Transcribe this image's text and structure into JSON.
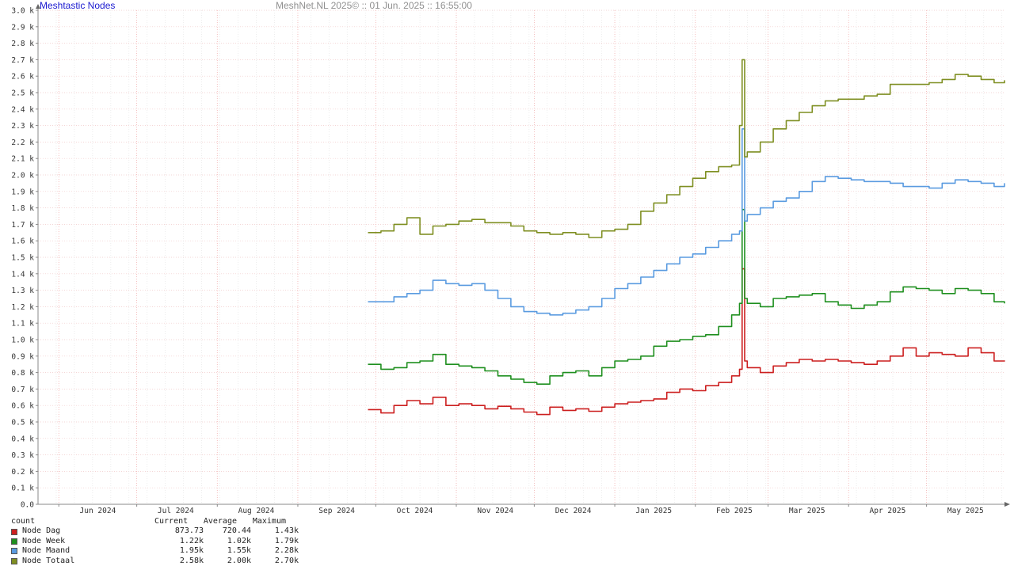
{
  "header": {
    "chart_title": "Meshtastic Nodes",
    "watermark": "MeshNet.NL 2025© ::  01 Jun. 2025 :: 16:55:00"
  },
  "legend": {
    "count_label": "count",
    "columns": [
      "Current",
      "Average",
      "Maximum"
    ],
    "rows": [
      {
        "name": "Node Dag",
        "color": "#cc1f1f",
        "current": "873.73",
        "average": "720.44",
        "maximum": "1.43k"
      },
      {
        "name": "Node Week",
        "color": "#1f8f1f",
        "current": "1.22k",
        "average": "1.02k",
        "maximum": "1.79k"
      },
      {
        "name": "Node Maand",
        "color": "#5a9be0",
        "current": "1.95k",
        "average": "1.55k",
        "maximum": "2.28k"
      },
      {
        "name": "Node Totaal",
        "color": "#7f8f22",
        "current": "2.58k",
        "average": "2.00k",
        "maximum": "2.70k"
      }
    ]
  },
  "chart_data": {
    "type": "line",
    "x_unit": "date",
    "x_range": [
      "2024-05-24",
      "2025-05-31"
    ],
    "ylim": [
      0,
      3000
    ],
    "y_tick_labels": [
      "0.0",
      "0.1 k",
      "0.2 k",
      "0.3 k",
      "0.4 k",
      "0.5 k",
      "0.6 k",
      "0.7 k",
      "0.8 k",
      "0.9 k",
      "1.0 k",
      "1.1 k",
      "1.2 k",
      "1.3 k",
      "1.4 k",
      "1.5 k",
      "1.6 k",
      "1.7 k",
      "1.8 k",
      "1.9 k",
      "2.0 k",
      "2.1 k",
      "2.2 k",
      "2.3 k",
      "2.4 k",
      "2.5 k",
      "2.6 k",
      "2.7 k",
      "2.8 k",
      "2.9 k",
      "3.0 k"
    ],
    "x_tick_labels": [
      "Jun 2024",
      "Jul 2024",
      "Aug 2024",
      "Sep 2024",
      "Oct 2024",
      "Nov 2024",
      "Dec 2024",
      "Jan 2025",
      "Feb 2025",
      "Mar 2025",
      "Apr 2025",
      "May 2025"
    ],
    "x_ticks": [
      "2024-06-01",
      "2024-07-01",
      "2024-08-01",
      "2024-09-01",
      "2024-10-01",
      "2024-11-01",
      "2024-12-01",
      "2025-01-01",
      "2025-02-01",
      "2025-03-01",
      "2025-04-01",
      "2025-05-01"
    ],
    "grid": true,
    "series": [
      {
        "name": "Node Dag",
        "color": "#cc1f1f",
        "x": [
          "2024-09-28",
          "2024-10-03",
          "2024-10-08",
          "2024-10-13",
          "2024-10-18",
          "2024-10-23",
          "2024-10-28",
          "2024-11-02",
          "2024-11-07",
          "2024-11-12",
          "2024-11-17",
          "2024-11-22",
          "2024-11-27",
          "2024-12-02",
          "2024-12-07",
          "2024-12-12",
          "2024-12-17",
          "2024-12-22",
          "2024-12-27",
          "2025-01-01",
          "2025-01-06",
          "2025-01-11",
          "2025-01-16",
          "2025-01-21",
          "2025-01-26",
          "2025-01-31",
          "2025-02-05",
          "2025-02-10",
          "2025-02-15",
          "2025-02-18",
          "2025-02-19",
          "2025-02-20",
          "2025-02-21",
          "2025-02-26",
          "2025-03-03",
          "2025-03-08",
          "2025-03-13",
          "2025-03-18",
          "2025-03-23",
          "2025-03-28",
          "2025-04-02",
          "2025-04-07",
          "2025-04-12",
          "2025-04-17",
          "2025-04-22",
          "2025-04-27",
          "2025-05-02",
          "2025-05-07",
          "2025-05-12",
          "2025-05-17",
          "2025-05-22",
          "2025-05-27",
          "2025-05-31"
        ],
        "y": [
          575,
          555,
          600,
          630,
          610,
          650,
          600,
          610,
          600,
          580,
          595,
          580,
          560,
          545,
          590,
          570,
          580,
          565,
          590,
          610,
          620,
          630,
          640,
          680,
          700,
          690,
          720,
          740,
          780,
          820,
          1430,
          870,
          830,
          800,
          840,
          860,
          880,
          870,
          880,
          870,
          860,
          850,
          870,
          900,
          950,
          900,
          920,
          910,
          900,
          950,
          920,
          870,
          873
        ]
      },
      {
        "name": "Node Week",
        "color": "#1f8f1f",
        "x": [
          "2024-09-28",
          "2024-10-03",
          "2024-10-08",
          "2024-10-13",
          "2024-10-18",
          "2024-10-23",
          "2024-10-28",
          "2024-11-02",
          "2024-11-07",
          "2024-11-12",
          "2024-11-17",
          "2024-11-22",
          "2024-11-27",
          "2024-12-02",
          "2024-12-07",
          "2024-12-12",
          "2024-12-17",
          "2024-12-22",
          "2024-12-27",
          "2025-01-01",
          "2025-01-06",
          "2025-01-11",
          "2025-01-16",
          "2025-01-21",
          "2025-01-26",
          "2025-01-31",
          "2025-02-05",
          "2025-02-10",
          "2025-02-15",
          "2025-02-18",
          "2025-02-19",
          "2025-02-20",
          "2025-02-21",
          "2025-02-26",
          "2025-03-03",
          "2025-03-08",
          "2025-03-13",
          "2025-03-18",
          "2025-03-23",
          "2025-03-28",
          "2025-04-02",
          "2025-04-07",
          "2025-04-12",
          "2025-04-17",
          "2025-04-22",
          "2025-04-27",
          "2025-05-02",
          "2025-05-07",
          "2025-05-12",
          "2025-05-17",
          "2025-05-22",
          "2025-05-27",
          "2025-05-31"
        ],
        "y": [
          850,
          820,
          830,
          860,
          870,
          910,
          850,
          840,
          830,
          810,
          780,
          760,
          740,
          730,
          780,
          800,
          810,
          780,
          830,
          870,
          880,
          900,
          960,
          990,
          1000,
          1020,
          1030,
          1080,
          1150,
          1220,
          1790,
          1250,
          1220,
          1200,
          1250,
          1260,
          1270,
          1280,
          1230,
          1210,
          1190,
          1210,
          1230,
          1290,
          1320,
          1310,
          1300,
          1280,
          1310,
          1300,
          1280,
          1230,
          1220
        ]
      },
      {
        "name": "Node Maand",
        "color": "#5a9be0",
        "x": [
          "2024-09-28",
          "2024-10-03",
          "2024-10-08",
          "2024-10-13",
          "2024-10-18",
          "2024-10-23",
          "2024-10-28",
          "2024-11-02",
          "2024-11-07",
          "2024-11-12",
          "2024-11-17",
          "2024-11-22",
          "2024-11-27",
          "2024-12-02",
          "2024-12-07",
          "2024-12-12",
          "2024-12-17",
          "2024-12-22",
          "2024-12-27",
          "2025-01-01",
          "2025-01-06",
          "2025-01-11",
          "2025-01-16",
          "2025-01-21",
          "2025-01-26",
          "2025-01-31",
          "2025-02-05",
          "2025-02-10",
          "2025-02-15",
          "2025-02-18",
          "2025-02-19",
          "2025-02-20",
          "2025-02-21",
          "2025-02-26",
          "2025-03-03",
          "2025-03-08",
          "2025-03-13",
          "2025-03-18",
          "2025-03-23",
          "2025-03-28",
          "2025-04-02",
          "2025-04-07",
          "2025-04-12",
          "2025-04-17",
          "2025-04-22",
          "2025-04-27",
          "2025-05-02",
          "2025-05-07",
          "2025-05-12",
          "2025-05-17",
          "2025-05-22",
          "2025-05-27",
          "2025-05-31"
        ],
        "y": [
          1230,
          1230,
          1260,
          1280,
          1300,
          1360,
          1340,
          1330,
          1340,
          1300,
          1250,
          1200,
          1170,
          1160,
          1150,
          1160,
          1180,
          1200,
          1250,
          1310,
          1340,
          1380,
          1420,
          1460,
          1500,
          1520,
          1560,
          1600,
          1640,
          1660,
          2280,
          1720,
          1760,
          1800,
          1840,
          1860,
          1900,
          1960,
          1990,
          1980,
          1970,
          1960,
          1960,
          1950,
          1930,
          1930,
          1920,
          1950,
          1970,
          1960,
          1950,
          1930,
          1950
        ]
      },
      {
        "name": "Node Totaal",
        "color": "#7f8f22",
        "x": [
          "2024-09-28",
          "2024-10-03",
          "2024-10-08",
          "2024-10-13",
          "2024-10-18",
          "2024-10-23",
          "2024-10-28",
          "2024-11-02",
          "2024-11-07",
          "2024-11-12",
          "2024-11-17",
          "2024-11-22",
          "2024-11-27",
          "2024-12-02",
          "2024-12-07",
          "2024-12-12",
          "2024-12-17",
          "2024-12-22",
          "2024-12-27",
          "2025-01-01",
          "2025-01-06",
          "2025-01-11",
          "2025-01-16",
          "2025-01-21",
          "2025-01-26",
          "2025-01-31",
          "2025-02-05",
          "2025-02-10",
          "2025-02-15",
          "2025-02-18",
          "2025-02-19",
          "2025-02-20",
          "2025-02-21",
          "2025-02-26",
          "2025-03-03",
          "2025-03-08",
          "2025-03-13",
          "2025-03-18",
          "2025-03-23",
          "2025-03-28",
          "2025-04-02",
          "2025-04-07",
          "2025-04-12",
          "2025-04-17",
          "2025-04-22",
          "2025-04-27",
          "2025-05-02",
          "2025-05-07",
          "2025-05-12",
          "2025-05-17",
          "2025-05-22",
          "2025-05-27",
          "2025-05-31"
        ],
        "y": [
          1650,
          1660,
          1700,
          1740,
          1640,
          1690,
          1700,
          1720,
          1730,
          1710,
          1710,
          1690,
          1660,
          1650,
          1640,
          1650,
          1640,
          1620,
          1660,
          1670,
          1700,
          1780,
          1830,
          1880,
          1930,
          1980,
          2020,
          2050,
          2060,
          2300,
          2700,
          2110,
          2140,
          2200,
          2280,
          2330,
          2380,
          2420,
          2450,
          2460,
          2460,
          2480,
          2490,
          2550,
          2550,
          2550,
          2560,
          2580,
          2610,
          2600,
          2580,
          2560,
          2575
        ]
      }
    ]
  }
}
